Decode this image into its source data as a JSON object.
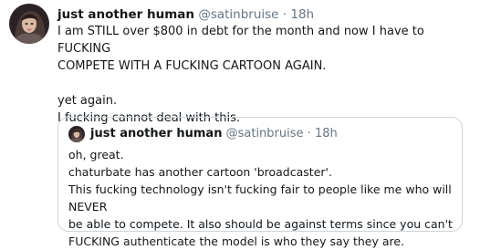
{
  "tweet": {
    "display_name": "just another human",
    "handle": "@satinbruise",
    "separator": "·",
    "time": "18h",
    "lines": [
      "I am STILL over $800 in debt for the month and now I have to FUCKING",
      "COMPETE WITH A FUCKING CARTOON AGAIN.",
      " ",
      "yet again.",
      "I fucking cannot deal with this."
    ]
  },
  "quoted": {
    "display_name": "just another human",
    "handle": "@satinbruise",
    "separator": "·",
    "time": "18h",
    "lines": [
      "oh, great.",
      "chaturbate has another cartoon 'broadcaster'.",
      "This fucking technology isn't fucking fair to people like me who will NEVER",
      "be able to compete. It also should be against terms since you can't",
      "FUCKING authenticate the model is who they say they are."
    ]
  },
  "icons": {
    "avatar": "profile-photo-icon",
    "quoted_avatar": "profile-photo-icon"
  }
}
